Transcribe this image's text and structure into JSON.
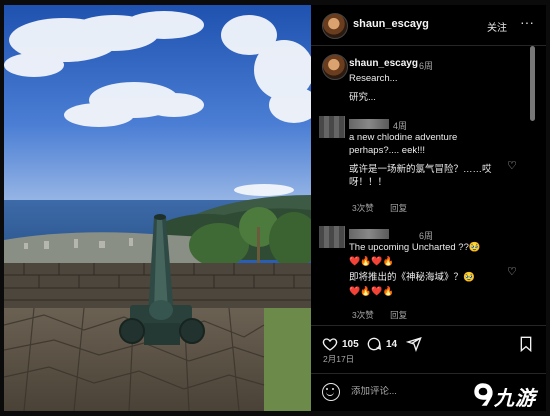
{
  "post": {
    "username": "shaun_escayg",
    "follow_label": "关注",
    "more_glyph": "···",
    "caption": {
      "username": "shaun_escayg",
      "time": "6周",
      "text_en": "Research...",
      "text_zh": "研究..."
    },
    "comments": [
      {
        "time": "4周",
        "text_en": "a new chlodine adventure perhaps?.... eek!!!",
        "text_zh": "或许是一场新的氯气冒险？……哎呀！！！",
        "likes": "3次赞",
        "reply": "回复"
      },
      {
        "time": "6周",
        "text_en": "The upcoming Uncharted ??🥹",
        "emoji_line_en": "❤️🔥❤️🔥",
        "text_zh": "即将推出的《神秘海域》？🥹",
        "emoji_line_zh": "❤️🔥❤️🔥",
        "likes": "3次赞",
        "reply": "回复"
      }
    ],
    "likes_count": "105",
    "comments_count": "14",
    "date": "2月17日",
    "add_comment_placeholder": "添加评论..."
  },
  "icons": {
    "like": "heart-icon",
    "comment": "comment-icon",
    "share": "send-icon",
    "save": "bookmark-icon",
    "emoji": "smile-icon"
  },
  "watermark": {
    "text": "九游"
  },
  "colors": {
    "panel_bg": "#000000",
    "text": "#f2f2f2",
    "secondary": "#a8a8a8",
    "sky": "#2a5eb5"
  }
}
